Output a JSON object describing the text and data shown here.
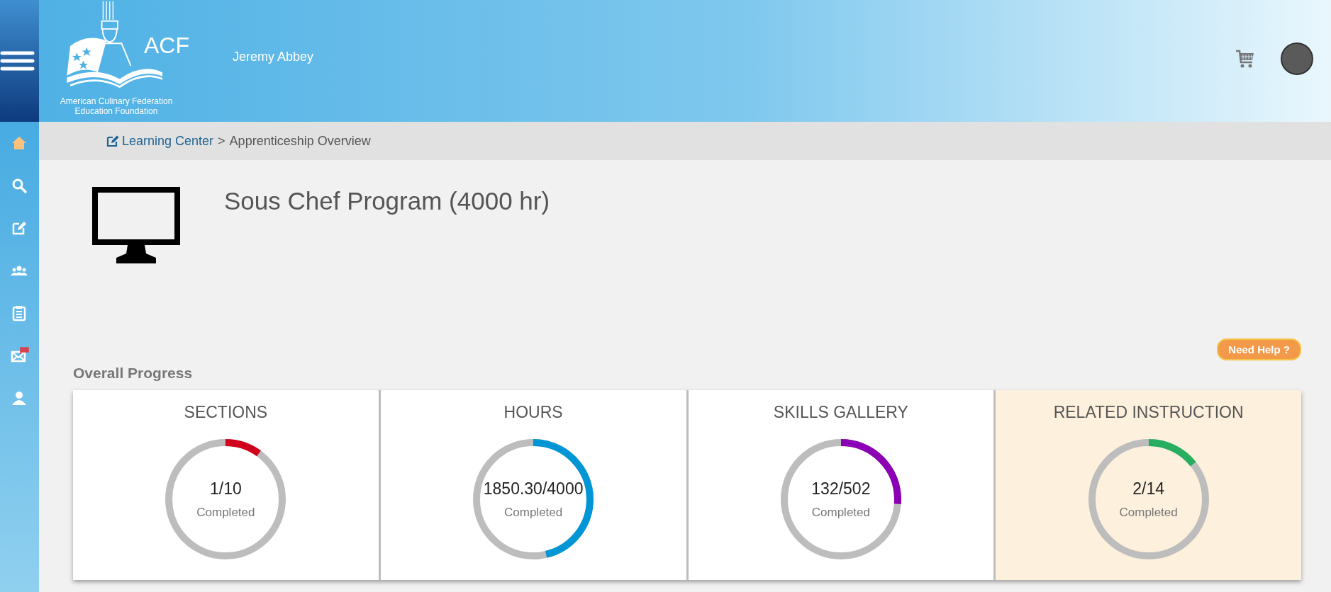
{
  "header": {
    "logo_mark": "ACF",
    "logo_lines": [
      "American Culinary Federation",
      "Education Foundation"
    ],
    "user_name": "Jeremy Abbey"
  },
  "sidebar": {
    "items": [
      {
        "kind": "home",
        "selected": true,
        "flagged": false
      },
      {
        "kind": "search",
        "selected": false,
        "flagged": false
      },
      {
        "kind": "edit",
        "selected": false,
        "flagged": false
      },
      {
        "kind": "group",
        "selected": false,
        "flagged": false
      },
      {
        "kind": "clipboard",
        "selected": false,
        "flagged": false
      },
      {
        "kind": "mail",
        "selected": false,
        "flagged": true
      },
      {
        "kind": "user",
        "selected": false,
        "flagged": false
      }
    ]
  },
  "breadcrumb": {
    "link": "Learning Center",
    "separator": ">",
    "current": "Apprenticeship Overview"
  },
  "program": {
    "title": "Sous Chef Program (4000 hr)"
  },
  "help_button": "Need Help ?",
  "progress": {
    "heading": "Overall Progress",
    "cards": [
      {
        "title": "SECTIONS",
        "value": "1/10",
        "caption": "Completed",
        "level": 0.1,
        "color": "#d0021b",
        "highlighted": false
      },
      {
        "title": "HOURS",
        "value": "1850.30/4000",
        "caption": "Completed",
        "level": 0.4626,
        "color": "#0096d6",
        "highlighted": false
      },
      {
        "title": "SKILLS GALLERY",
        "value": "132/502",
        "caption": "Completed",
        "level": 0.263,
        "color": "#8b00b5",
        "highlighted": false
      },
      {
        "title": "RELATED INSTRUCTION",
        "value": "2/14",
        "caption": "Completed",
        "level": 0.143,
        "color": "#27ae60",
        "highlighted": true
      }
    ]
  }
}
